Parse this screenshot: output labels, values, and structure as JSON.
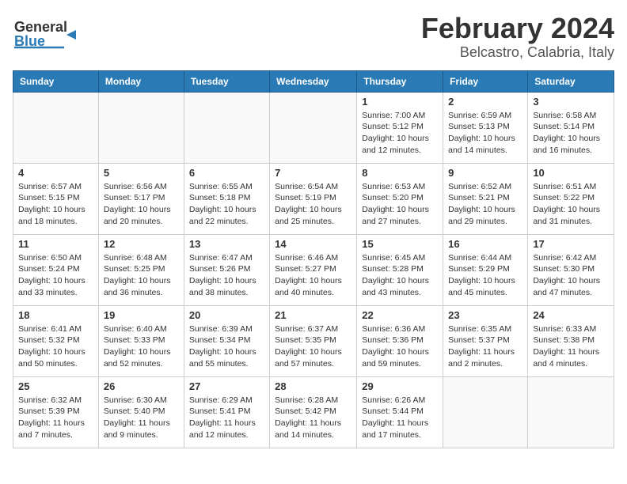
{
  "logo": {
    "text_general": "General",
    "text_blue": "Blue"
  },
  "title": {
    "month_year": "February 2024",
    "location": "Belcastro, Calabria, Italy"
  },
  "days_of_week": [
    "Sunday",
    "Monday",
    "Tuesday",
    "Wednesday",
    "Thursday",
    "Friday",
    "Saturday"
  ],
  "weeks": [
    [
      {
        "day": "",
        "info": ""
      },
      {
        "day": "",
        "info": ""
      },
      {
        "day": "",
        "info": ""
      },
      {
        "day": "",
        "info": ""
      },
      {
        "day": "1",
        "info": "Sunrise: 7:00 AM\nSunset: 5:12 PM\nDaylight: 10 hours\nand 12 minutes."
      },
      {
        "day": "2",
        "info": "Sunrise: 6:59 AM\nSunset: 5:13 PM\nDaylight: 10 hours\nand 14 minutes."
      },
      {
        "day": "3",
        "info": "Sunrise: 6:58 AM\nSunset: 5:14 PM\nDaylight: 10 hours\nand 16 minutes."
      }
    ],
    [
      {
        "day": "4",
        "info": "Sunrise: 6:57 AM\nSunset: 5:15 PM\nDaylight: 10 hours\nand 18 minutes."
      },
      {
        "day": "5",
        "info": "Sunrise: 6:56 AM\nSunset: 5:17 PM\nDaylight: 10 hours\nand 20 minutes."
      },
      {
        "day": "6",
        "info": "Sunrise: 6:55 AM\nSunset: 5:18 PM\nDaylight: 10 hours\nand 22 minutes."
      },
      {
        "day": "7",
        "info": "Sunrise: 6:54 AM\nSunset: 5:19 PM\nDaylight: 10 hours\nand 25 minutes."
      },
      {
        "day": "8",
        "info": "Sunrise: 6:53 AM\nSunset: 5:20 PM\nDaylight: 10 hours\nand 27 minutes."
      },
      {
        "day": "9",
        "info": "Sunrise: 6:52 AM\nSunset: 5:21 PM\nDaylight: 10 hours\nand 29 minutes."
      },
      {
        "day": "10",
        "info": "Sunrise: 6:51 AM\nSunset: 5:22 PM\nDaylight: 10 hours\nand 31 minutes."
      }
    ],
    [
      {
        "day": "11",
        "info": "Sunrise: 6:50 AM\nSunset: 5:24 PM\nDaylight: 10 hours\nand 33 minutes."
      },
      {
        "day": "12",
        "info": "Sunrise: 6:48 AM\nSunset: 5:25 PM\nDaylight: 10 hours\nand 36 minutes."
      },
      {
        "day": "13",
        "info": "Sunrise: 6:47 AM\nSunset: 5:26 PM\nDaylight: 10 hours\nand 38 minutes."
      },
      {
        "day": "14",
        "info": "Sunrise: 6:46 AM\nSunset: 5:27 PM\nDaylight: 10 hours\nand 40 minutes."
      },
      {
        "day": "15",
        "info": "Sunrise: 6:45 AM\nSunset: 5:28 PM\nDaylight: 10 hours\nand 43 minutes."
      },
      {
        "day": "16",
        "info": "Sunrise: 6:44 AM\nSunset: 5:29 PM\nDaylight: 10 hours\nand 45 minutes."
      },
      {
        "day": "17",
        "info": "Sunrise: 6:42 AM\nSunset: 5:30 PM\nDaylight: 10 hours\nand 47 minutes."
      }
    ],
    [
      {
        "day": "18",
        "info": "Sunrise: 6:41 AM\nSunset: 5:32 PM\nDaylight: 10 hours\nand 50 minutes."
      },
      {
        "day": "19",
        "info": "Sunrise: 6:40 AM\nSunset: 5:33 PM\nDaylight: 10 hours\nand 52 minutes."
      },
      {
        "day": "20",
        "info": "Sunrise: 6:39 AM\nSunset: 5:34 PM\nDaylight: 10 hours\nand 55 minutes."
      },
      {
        "day": "21",
        "info": "Sunrise: 6:37 AM\nSunset: 5:35 PM\nDaylight: 10 hours\nand 57 minutes."
      },
      {
        "day": "22",
        "info": "Sunrise: 6:36 AM\nSunset: 5:36 PM\nDaylight: 10 hours\nand 59 minutes."
      },
      {
        "day": "23",
        "info": "Sunrise: 6:35 AM\nSunset: 5:37 PM\nDaylight: 11 hours\nand 2 minutes."
      },
      {
        "day": "24",
        "info": "Sunrise: 6:33 AM\nSunset: 5:38 PM\nDaylight: 11 hours\nand 4 minutes."
      }
    ],
    [
      {
        "day": "25",
        "info": "Sunrise: 6:32 AM\nSunset: 5:39 PM\nDaylight: 11 hours\nand 7 minutes."
      },
      {
        "day": "26",
        "info": "Sunrise: 6:30 AM\nSunset: 5:40 PM\nDaylight: 11 hours\nand 9 minutes."
      },
      {
        "day": "27",
        "info": "Sunrise: 6:29 AM\nSunset: 5:41 PM\nDaylight: 11 hours\nand 12 minutes."
      },
      {
        "day": "28",
        "info": "Sunrise: 6:28 AM\nSunset: 5:42 PM\nDaylight: 11 hours\nand 14 minutes."
      },
      {
        "day": "29",
        "info": "Sunrise: 6:26 AM\nSunset: 5:44 PM\nDaylight: 11 hours\nand 17 minutes."
      },
      {
        "day": "",
        "info": ""
      },
      {
        "day": "",
        "info": ""
      }
    ]
  ]
}
